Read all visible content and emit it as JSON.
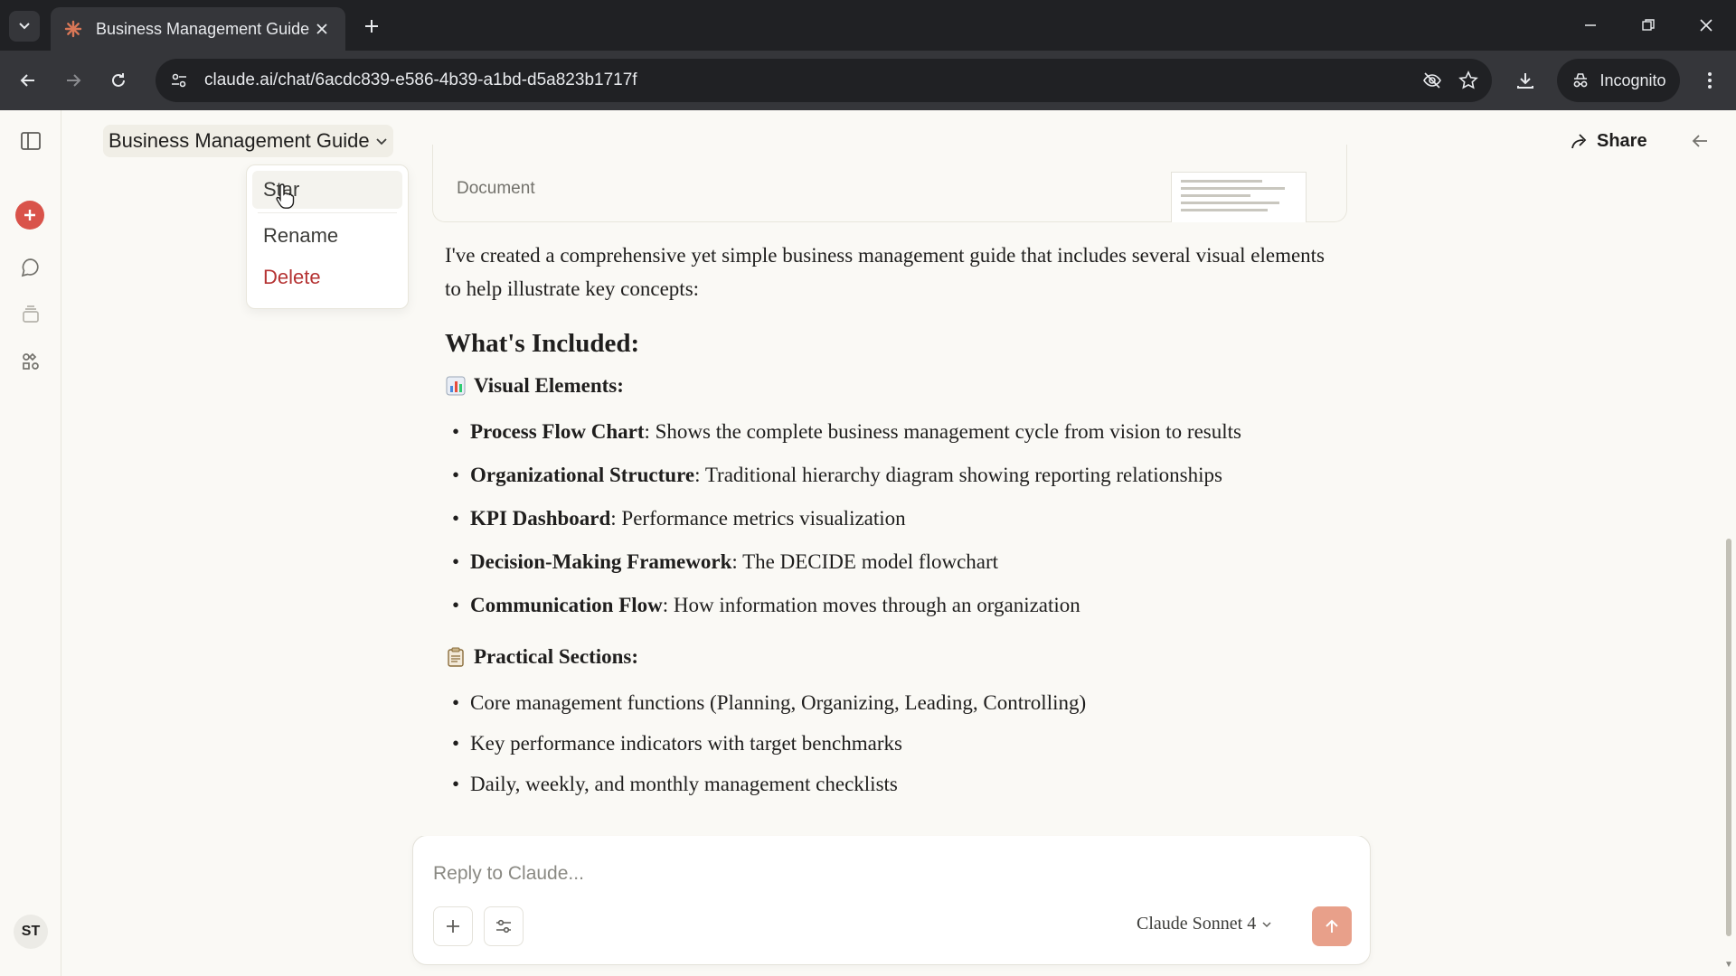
{
  "browser": {
    "tab_title": "Business Management Guide -",
    "url": "claude.ai/chat/6acdc839-e586-4b39-a1bd-d5a823b1717f",
    "incognito_label": "Incognito"
  },
  "header": {
    "chat_title": "Business Management Guide",
    "share_label": "Share"
  },
  "menu": {
    "items": [
      "Star",
      "Rename",
      "Delete"
    ]
  },
  "doc_card": {
    "label": "Document"
  },
  "message": {
    "intro": "I've created a comprehensive yet simple business management guide that includes several visual elements to help illustrate key concepts:",
    "heading": "What's Included:",
    "visual_heading": "Visual Elements:",
    "visual_items": [
      {
        "bold": "Process Flow Chart",
        "text": ": Shows the complete business management cycle from vision to results"
      },
      {
        "bold": "Organizational Structure",
        "text": ": Traditional hierarchy diagram showing reporting relationships"
      },
      {
        "bold": "KPI Dashboard",
        "text": ": Performance metrics visualization"
      },
      {
        "bold": "Decision-Making Framework",
        "text": ": The DECIDE model flowchart"
      },
      {
        "bold": "Communication Flow",
        "text": ": How information moves through an organization"
      }
    ],
    "practical_heading": "Practical Sections:",
    "practical_items": [
      "Core management functions (Planning, Organizing, Leading, Controlling)",
      "Key performance indicators with target benchmarks",
      "Daily, weekly, and monthly management checklists"
    ]
  },
  "composer": {
    "placeholder": "Reply to Claude...",
    "model": "Claude Sonnet 4"
  },
  "user": {
    "initials": "ST"
  },
  "colors": {
    "accent": "#d97757",
    "new_chat": "#d9534a",
    "danger": "#b53333",
    "send": "#e8a08a"
  }
}
